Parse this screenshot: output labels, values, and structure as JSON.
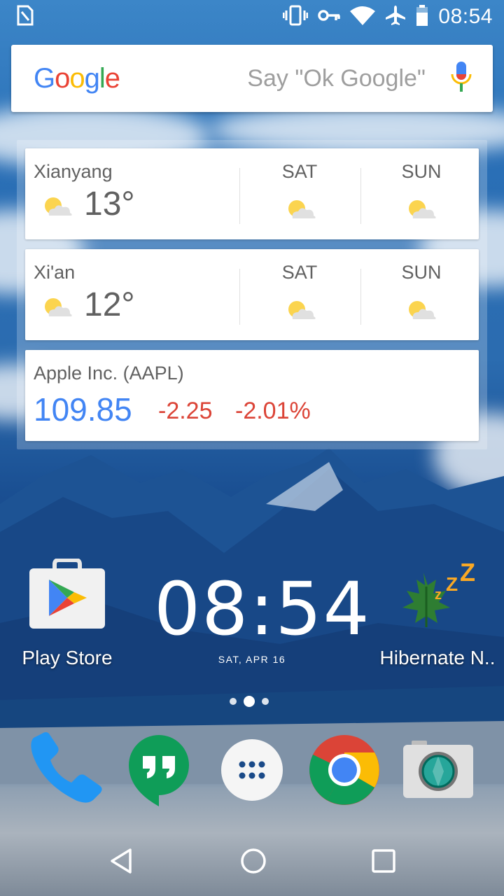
{
  "status_bar": {
    "time": "08:54",
    "icons": [
      "sim-card-icon",
      "vibrate-icon",
      "vpn-key-icon",
      "wifi-icon",
      "airplane-icon",
      "battery-icon"
    ]
  },
  "search": {
    "logo_letters": [
      "G",
      "o",
      "o",
      "g",
      "l",
      "e"
    ],
    "placeholder": "Say \"Ok Google\"",
    "mic_icon": "mic-icon"
  },
  "weather": [
    {
      "city": "Xianyang",
      "temp": "13°",
      "days": [
        {
          "label": "SAT",
          "icon": "partly-cloudy-icon"
        },
        {
          "label": "SUN",
          "icon": "partly-cloudy-icon"
        }
      ]
    },
    {
      "city": "Xi'an",
      "temp": "12°",
      "days": [
        {
          "label": "SAT",
          "icon": "partly-cloudy-icon"
        },
        {
          "label": "SUN",
          "icon": "partly-cloudy-icon"
        }
      ]
    }
  ],
  "stock": {
    "name": "Apple Inc. (AAPL)",
    "price": "109.85",
    "change": "-2.25",
    "percent": "-2.01%"
  },
  "home": {
    "apps": [
      {
        "label": "Play Store",
        "icon": "play-store-icon"
      },
      {
        "label": "Hibernate N..",
        "icon": "hibernate-icon"
      }
    ],
    "clock": {
      "time": "08:54",
      "date": "SAT, APR 16"
    }
  },
  "pages": {
    "count": 3,
    "active": 1
  },
  "dock": [
    {
      "name": "phone-icon"
    },
    {
      "name": "hangouts-icon"
    },
    {
      "name": "app-drawer-icon"
    },
    {
      "name": "chrome-icon"
    },
    {
      "name": "camera-icon"
    }
  ],
  "nav": [
    "back-icon",
    "home-icon",
    "recents-icon"
  ],
  "colors": {
    "google_blue": "#4285f4",
    "google_red": "#ea4335",
    "google_yellow": "#fbbc05",
    "google_green": "#34a853",
    "stock_negative": "#db4437"
  }
}
